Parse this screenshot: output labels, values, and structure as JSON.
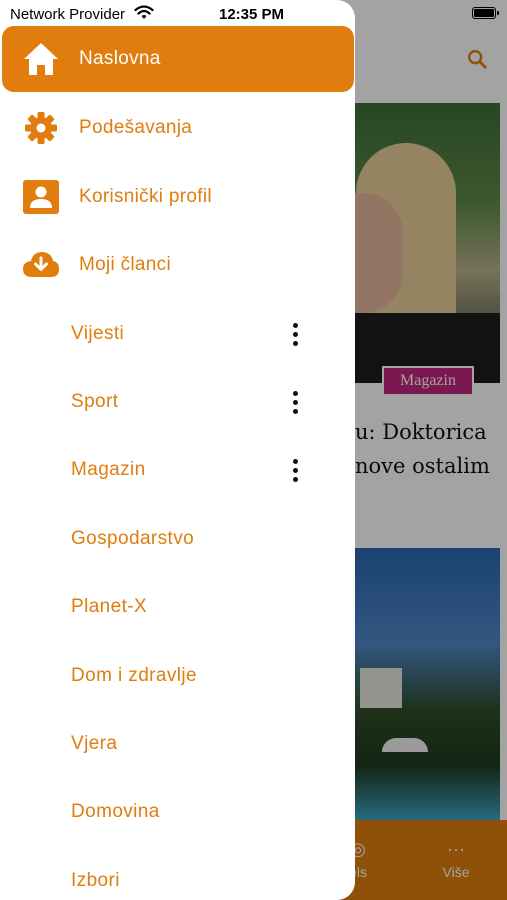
{
  "status_bar": {
    "carrier": "Network Provider",
    "time": "12:35 PM"
  },
  "background": {
    "article_tag": "Magazin",
    "headline": "u: Doktorica nove ostalim",
    "tabs": [
      {
        "label": "els",
        "icon": "play-circle-icon"
      },
      {
        "label": "Više",
        "icon": "ellipsis-icon"
      }
    ]
  },
  "drawer": {
    "menu": [
      {
        "label": "Naslovna",
        "icon": "home-icon",
        "active": true
      },
      {
        "label": "Podešavanja",
        "icon": "gear-icon",
        "active": false
      },
      {
        "label": "Korisnički profil",
        "icon": "user-profile-icon",
        "active": false
      },
      {
        "label": "Moji članci",
        "icon": "cloud-download-icon",
        "active": false
      }
    ],
    "categories": [
      {
        "label": "Vijesti",
        "has_more": true
      },
      {
        "label": "Sport",
        "has_more": true
      },
      {
        "label": "Magazin",
        "has_more": true
      },
      {
        "label": "Gospodarstvo",
        "has_more": false
      },
      {
        "label": "Planet-X",
        "has_more": false
      },
      {
        "label": "Dom i zdravlje",
        "has_more": false
      },
      {
        "label": "Vjera",
        "has_more": false
      },
      {
        "label": "Domovina",
        "has_more": false
      },
      {
        "label": "Izbori",
        "has_more": false
      }
    ]
  },
  "colors": {
    "accent": "#e07d0e",
    "tag": "#c0267e"
  }
}
